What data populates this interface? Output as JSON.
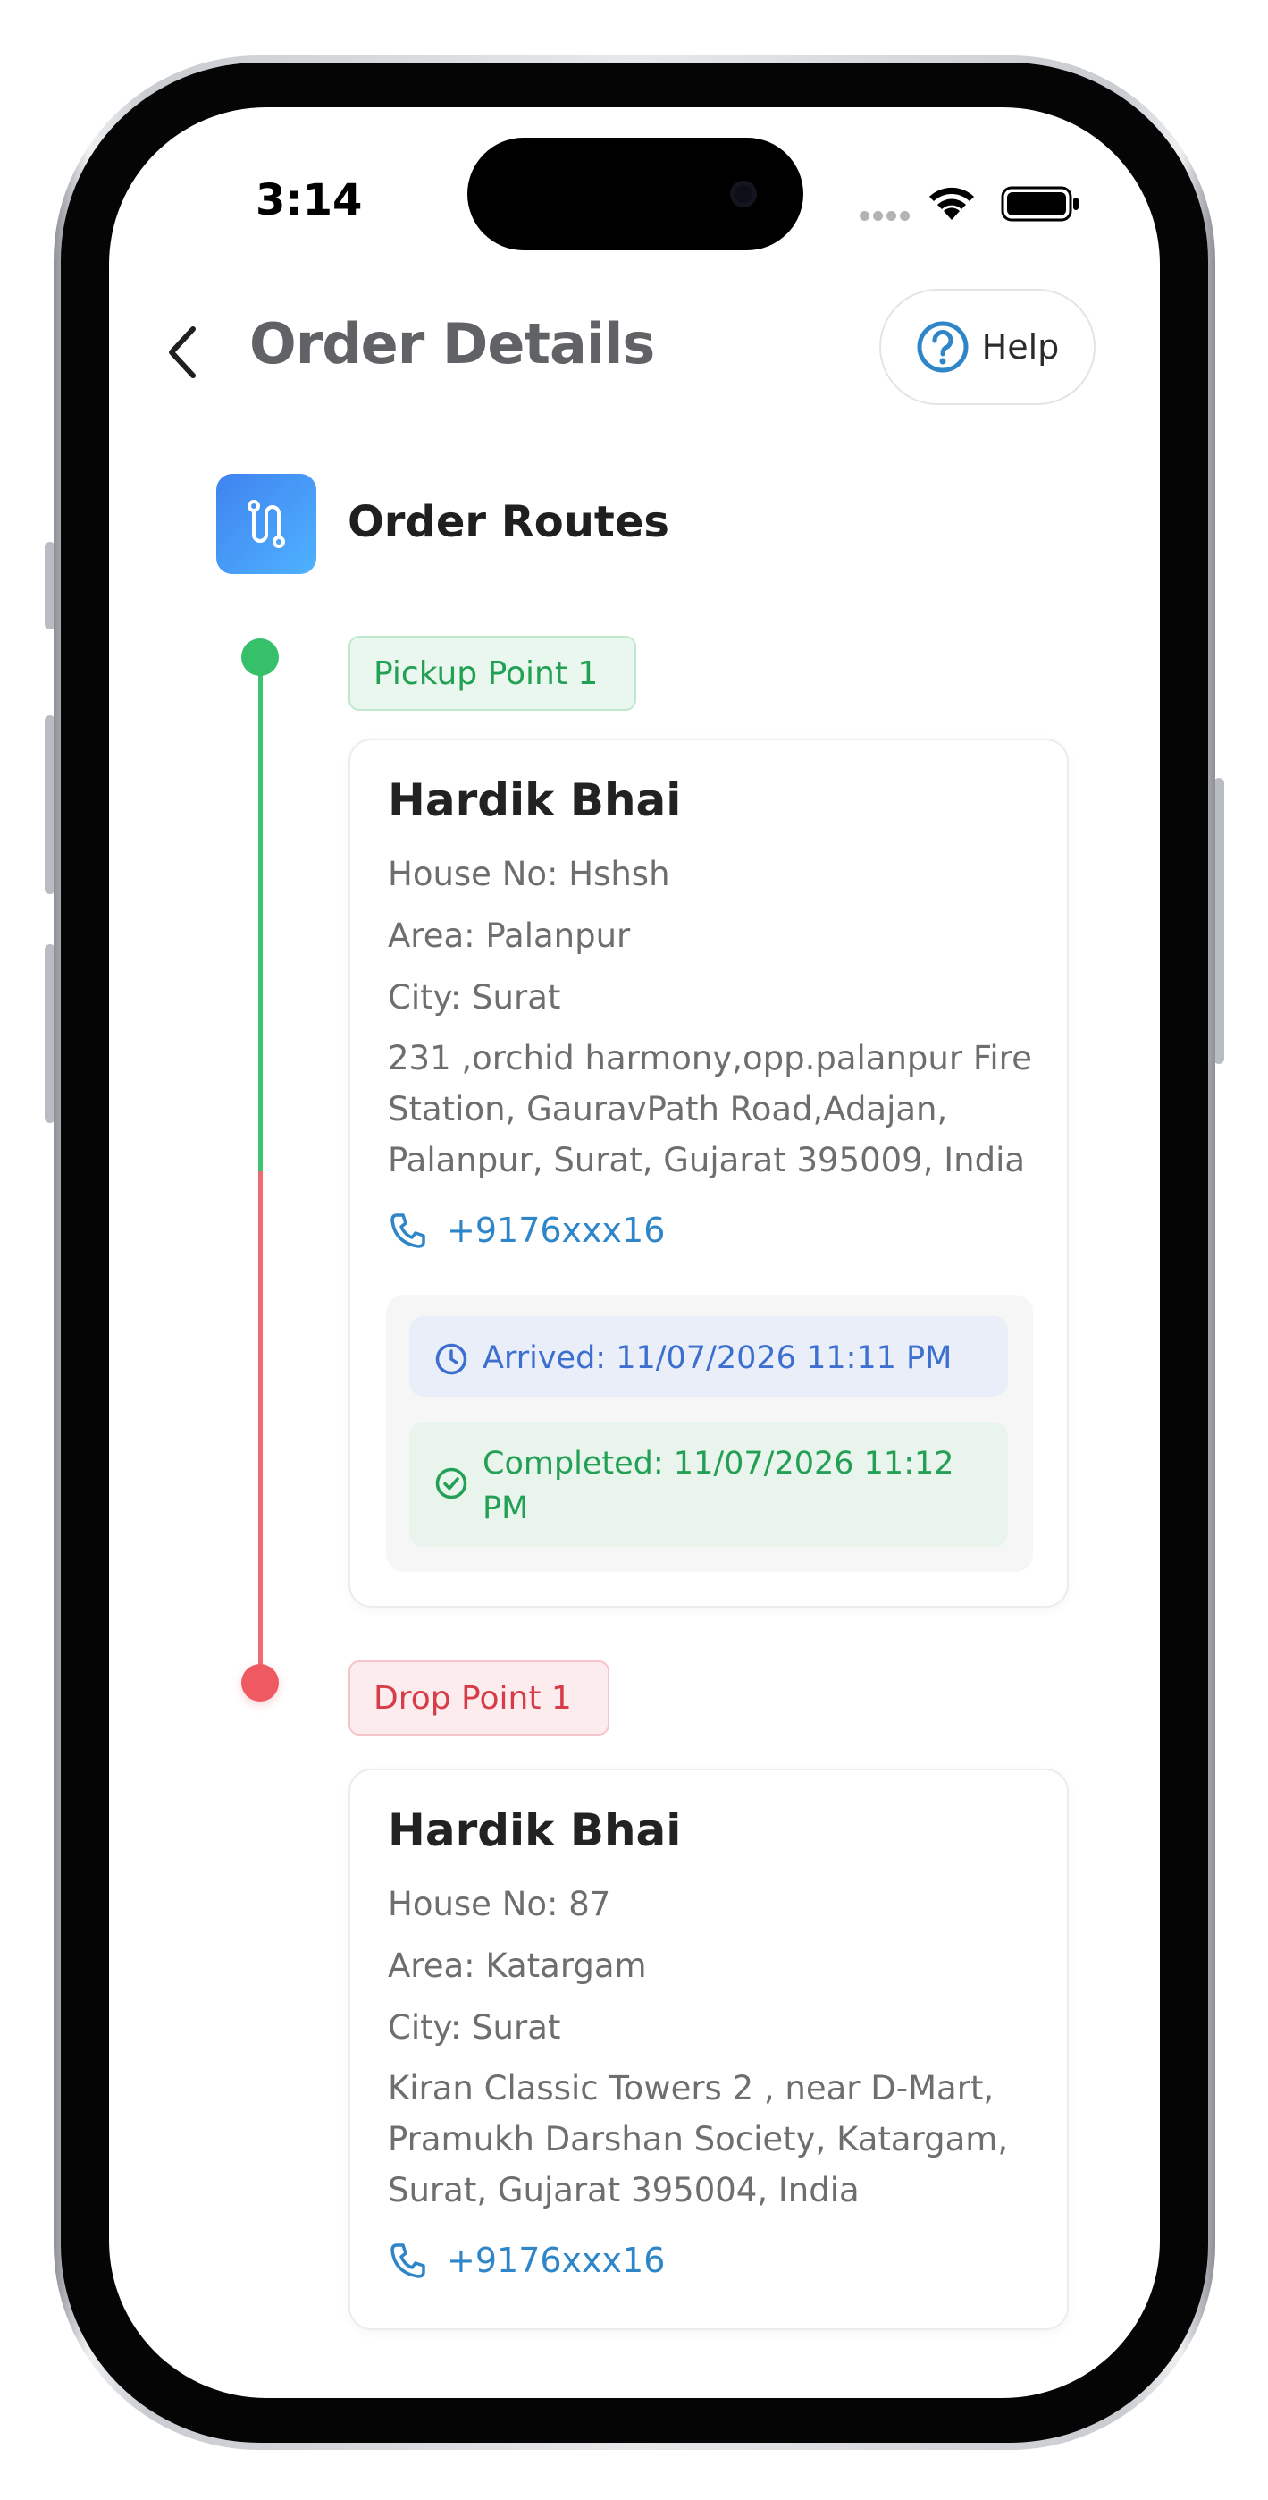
{
  "status_bar": {
    "time": "3:14"
  },
  "header": {
    "title": "Order Details",
    "help_label": "Help"
  },
  "section": {
    "title": "Order Routes"
  },
  "routes": [
    {
      "tag": "Pickup Point 1",
      "name": "Hardik Bhai",
      "house": "House No: Hshsh",
      "area": "Area: Palanpur",
      "city": "City: Surat",
      "address": "231 ,orchid harmony,opp.palanpur Fire Station, GauravPath Road,Adajan, Palanpur, Surat, Gujarat 395009, India",
      "phone": "+9176xxx16",
      "arrived": "Arrived: 11/07/2026 11:11 PM",
      "completed": "Completed: 11/07/2026 11:12 PM"
    },
    {
      "tag": "Drop Point 1",
      "name": "Hardik Bhai",
      "house": "House No: 87",
      "area": "Area: Katargam",
      "city": "City: Surat",
      "address": "Kiran Classic Towers 2 , near D-Mart, Pramukh Darshan Society, Katargam, Surat, Gujarat 395004, India",
      "phone": "+9176xxx16"
    }
  ],
  "colors": {
    "pickup": "#36c06a",
    "drop": "#ef5a62",
    "link": "#2e86c9",
    "accent": "#3f83ef"
  },
  "icons": [
    "back-chevron-icon",
    "help-circle-icon",
    "route-icon",
    "phone-icon",
    "clock-icon",
    "check-circle-icon",
    "wifi-icon",
    "battery-icon"
  ]
}
